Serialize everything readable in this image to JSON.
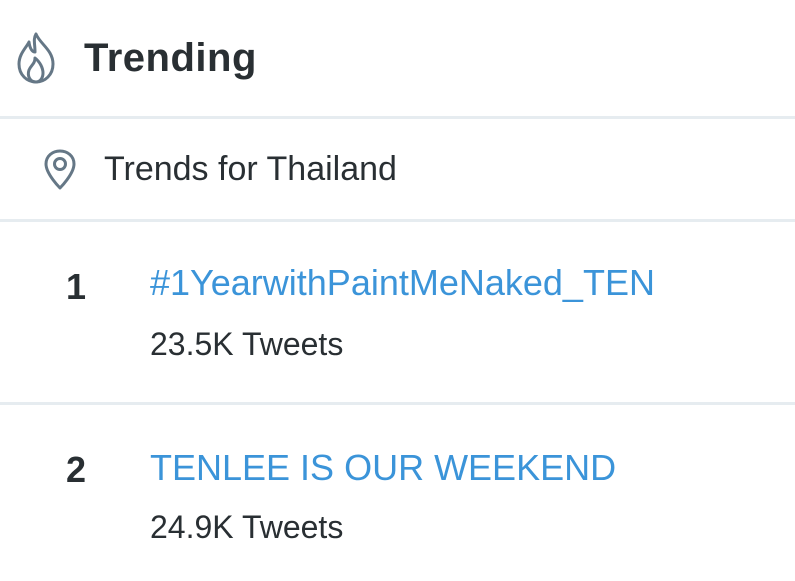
{
  "header": {
    "icon": "flame-icon",
    "title": "Trending"
  },
  "location": {
    "icon": "location-pin-icon",
    "label": "Trends for Thailand"
  },
  "trends": [
    {
      "rank": "1",
      "name": "#1YearwithPaintMeNaked_TEN",
      "count": "23.5K Tweets"
    },
    {
      "rank": "2",
      "name": "TENLEE IS OUR WEEKEND",
      "count": "24.9K Tweets"
    }
  ],
  "colors": {
    "link": "#3b94d9",
    "text": "#292f33",
    "divider": "#e6ecf0",
    "icon": "#657786"
  }
}
